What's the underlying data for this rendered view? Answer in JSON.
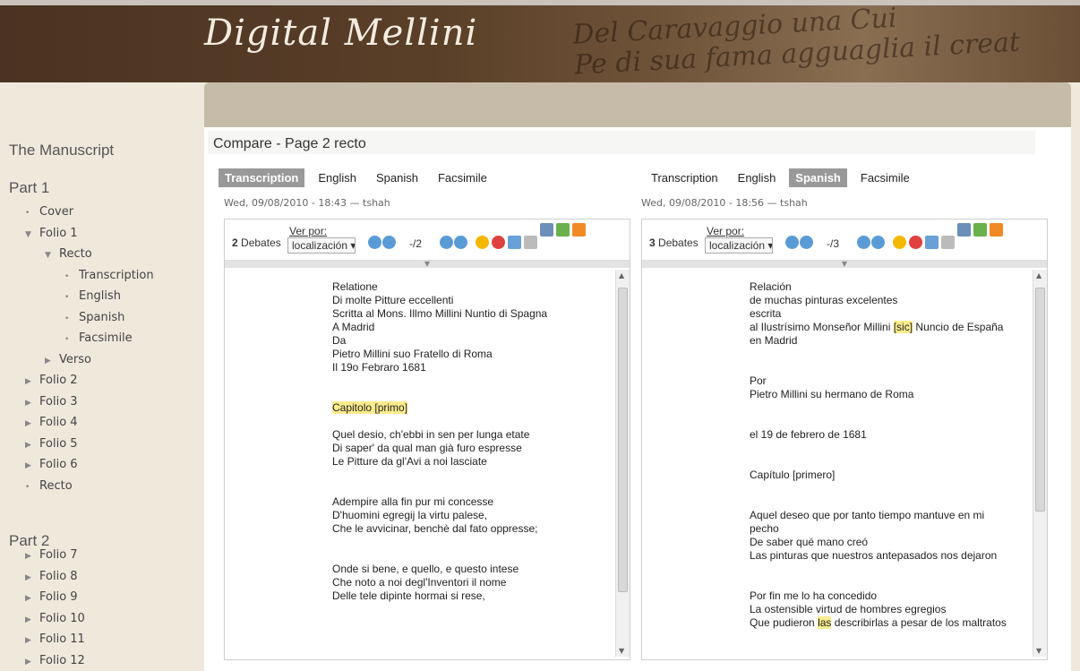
{
  "header": {
    "logo": "Digital Mellini",
    "script_line1": "Del Caravaggio una Cui",
    "script_line2": "Pe di sua fama agguaglia il creat"
  },
  "sidebar": {
    "heading": "The Manuscript",
    "parts": [
      {
        "label": "Part 1",
        "items": [
          {
            "label": "Cover",
            "marker": "•",
            "level": 0
          },
          {
            "label": "Folio 1",
            "marker": "▼",
            "level": 0
          },
          {
            "label": "Recto",
            "marker": "▼",
            "level": 1
          },
          {
            "label": "Transcription",
            "marker": "•",
            "level": 2
          },
          {
            "label": "English",
            "marker": "•",
            "level": 2
          },
          {
            "label": "Spanish",
            "marker": "•",
            "level": 2
          },
          {
            "label": "Facsimile",
            "marker": "•",
            "level": 2
          },
          {
            "label": "Verso",
            "marker": "▶",
            "level": 1
          },
          {
            "label": "Folio 2",
            "marker": "▶",
            "level": 0
          },
          {
            "label": "Folio 3",
            "marker": "▶",
            "level": 0
          },
          {
            "label": "Folio 4",
            "marker": "▶",
            "level": 0
          },
          {
            "label": "Folio 5",
            "marker": "▶",
            "level": 0
          },
          {
            "label": "Folio 6",
            "marker": "▶",
            "level": 0
          },
          {
            "label": "Recto",
            "marker": "•",
            "level": 0
          }
        ]
      },
      {
        "label": "Part 2",
        "items": [
          {
            "label": "Folio 7",
            "marker": "▶",
            "level": 0
          },
          {
            "label": "Folio 8",
            "marker": "▶",
            "level": 0
          },
          {
            "label": "Folio 9",
            "marker": "▶",
            "level": 0
          },
          {
            "label": "Folio 10",
            "marker": "▶",
            "level": 0
          },
          {
            "label": "Folio 11",
            "marker": "▶",
            "level": 0
          },
          {
            "label": "Folio 12",
            "marker": "▶",
            "level": 0
          }
        ]
      }
    ]
  },
  "main": {
    "title": "Compare - Page 2 recto",
    "left": {
      "tabs": [
        "Transcription",
        "English",
        "Spanish",
        "Facsimile"
      ],
      "active": 0,
      "meta": "Wed, 09/08/2010 - 18:43 — tshah",
      "debates_count": "2",
      "debates_label": "Debates",
      "ver_por": "Ver por:",
      "select_value": "localización",
      "page_indicator": "-/2",
      "lines": [
        "Relatione",
        "Di molte Pitture eccellenti",
        "Scritta al Mons. Illmo Millini Nuntio di Spagna",
        "A Madrid",
        "Da",
        "Pietro Millini suo Fratello di Roma",
        "Il 19o Febraro 1681",
        "",
        "",
        "Capitolo [primo]",
        "",
        "Quel desio, ch'ebbi in sen per lunga etate",
        "Di saper' da qual man già furo espresse",
        "Le Pitture da gl'Avi a noi lasciate",
        "",
        "",
        "Adempire alla fin pur mi concesse",
        "D'huomini egregij la virtu palese,",
        "Che le avvicinar, benchè dal fato oppresse;",
        "",
        "",
        "Onde si bene, e quello, e questo intese",
        "Che noto a noi degl'Inventori il nome",
        "Delle tele dipinte hormai si rese,"
      ]
    },
    "right": {
      "tabs": [
        "Transcription",
        "English",
        "Spanish",
        "Facsimile"
      ],
      "active": 2,
      "meta": "Wed, 09/08/2010 - 18:56 — tshah",
      "debates_count": "3",
      "debates_label": "Debates",
      "ver_por": "Ver por:",
      "select_value": "localización",
      "page_indicator": "-/3",
      "lines": [
        "Relación",
        "de muchas pinturas excelentes",
        "escrita",
        "al Ilustrísimo Monseñor Millini [sic] Nuncio de España",
        "en Madrid",
        "",
        "",
        "Por",
        "Pietro Millini su hermano de Roma",
        "",
        "",
        "el 19 de febrero de 1681",
        "",
        "",
        "Capítulo [primero]",
        "",
        "",
        "Aquel deseo que por tanto tiempo mantuve en mi",
        "pecho",
        "De saber qué mano creó",
        "Las pinturas que nuestros antepasados nos dejaron",
        "",
        "",
        "Por fin me lo ha concedido",
        "La ostensible virtud de hombres egregios",
        "Que pudieron las describirlas a pesar de los maltratos"
      ]
    }
  },
  "colors": {
    "banner": "#5a3f28",
    "active_tab": "#999999",
    "highlight": "#fbeb8c",
    "graybar": "#c6bba9"
  }
}
